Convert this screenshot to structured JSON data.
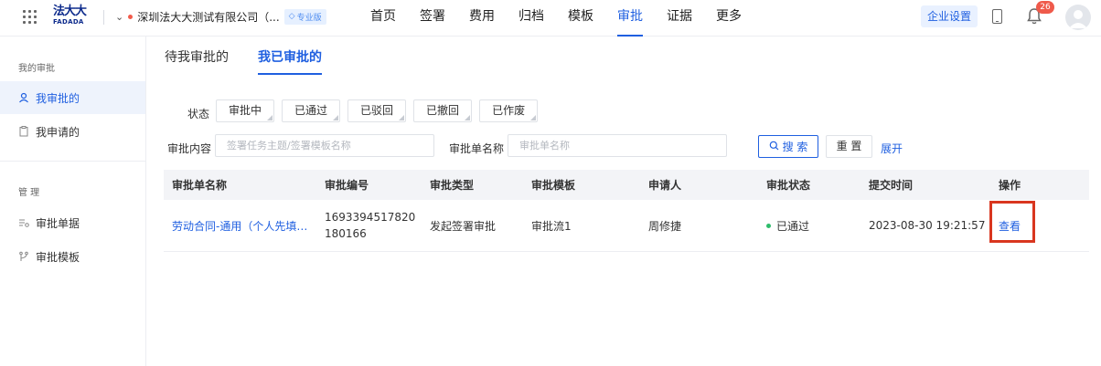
{
  "header": {
    "logo_line1": "法大大",
    "logo_line2": "FADADA",
    "company_name": "深圳法大大测试有限公司（...",
    "plan_badge": "专业版",
    "nav": [
      "首页",
      "签署",
      "费用",
      "归档",
      "模板",
      "审批",
      "证据",
      "更多"
    ],
    "active_nav": "审批",
    "settings_button": "企业设置",
    "notification_count": "26"
  },
  "sidebar": {
    "section1": "我的审批",
    "items1": [
      "我审批的",
      "我申请的"
    ],
    "section2": "管 理",
    "items2": [
      "审批单据",
      "审批模板"
    ]
  },
  "tabs": [
    "待我审批的",
    "我已审批的"
  ],
  "filters": {
    "status_label": "状态",
    "status_options": [
      "审批中",
      "已通过",
      "已驳回",
      "已撤回",
      "已作废"
    ],
    "content_label": "审批内容",
    "content_placeholder": "签署任务主题/签署模板名称",
    "name_label": "审批单名称",
    "name_placeholder": "审批单名称",
    "search_button": "搜 索",
    "reset_button": "重 置",
    "expand_link": "展开"
  },
  "table": {
    "columns": [
      "审批单名称",
      "审批编号",
      "审批类型",
      "审批模板",
      "申请人",
      "审批状态",
      "提交时间",
      "操作"
    ],
    "rows": [
      {
        "name": "劳动合同-通用（个人先填，...",
        "number": "1693394517820180166",
        "type": "发起签署审批",
        "template": "审批流1",
        "applicant": "周修捷",
        "status": "已通过",
        "submitted": "2023-08-30 19:21:57",
        "action": "查看"
      }
    ]
  }
}
